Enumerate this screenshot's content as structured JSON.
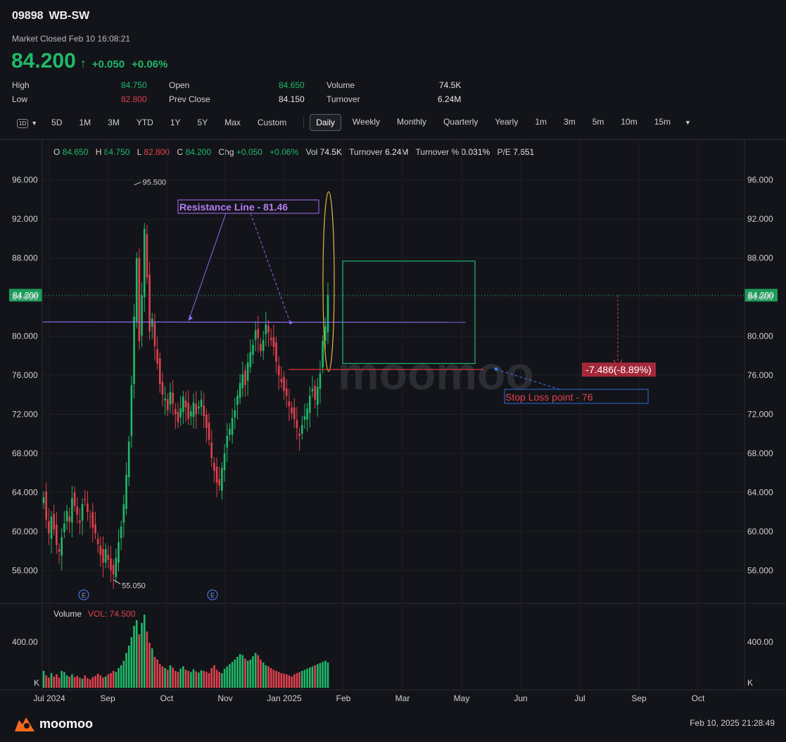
{
  "header": {
    "code": "09898",
    "name": "WB-SW",
    "market_status": "Market Closed Feb 10 16:08:21",
    "price": "84.200",
    "change": "+0.050",
    "change_pct": "+0.06%"
  },
  "stats": {
    "high_label": "High",
    "high": "84.750",
    "low_label": "Low",
    "low": "82.800",
    "open_label": "Open",
    "open": "84.650",
    "prev_close_label": "Prev Close",
    "prev_close": "84.150",
    "volume_label": "Volume",
    "volume": "74.5K",
    "turnover_label": "Turnover",
    "turnover": "6.24M"
  },
  "tabs": {
    "period_icon": "1D",
    "ranges": [
      "5D",
      "1M",
      "3M",
      "YTD",
      "1Y",
      "5Y",
      "Max",
      "Custom"
    ],
    "intervals": [
      "Daily",
      "Weekly",
      "Monthly",
      "Quarterly",
      "Yearly",
      "1m",
      "3m",
      "5m",
      "10m",
      "15m"
    ],
    "active": "Daily"
  },
  "ohlc_bar": {
    "o_label": "O",
    "o": "84.650",
    "h_label": "H",
    "h": "84.750",
    "l_label": "L",
    "l": "82.800",
    "c_label": "C",
    "c": "84.200",
    "chg_label": "Chg",
    "chg": "+0.050",
    "chg_pct": "+0.06%",
    "vol_label": "Vol",
    "vol": "74.5K",
    "turnover_label": "Turnover",
    "turnover": "6.24M",
    "turnover_pct_label": "Turnover %",
    "turnover_pct": "0.031%",
    "pe_label": "P/E",
    "pe": "7.651"
  },
  "chart_data": {
    "type": "candlestick",
    "y_ticks": [
      "96.000",
      "92.000",
      "88.000",
      "84.000",
      "80.000",
      "76.000",
      "72.000",
      "68.000",
      "64.000",
      "60.000",
      "56.000"
    ],
    "y_tick_values": [
      96,
      92,
      88,
      84,
      80,
      76,
      72,
      68,
      64,
      60,
      56
    ],
    "ylim": [
      53.5,
      98
    ],
    "x_ticks": [
      "Jul 2024",
      "Sep",
      "Oct",
      "Nov",
      "Jan 2025",
      "Feb",
      "Mar",
      "May",
      "Jun",
      "Jul",
      "Sep",
      "Oct"
    ],
    "last_price_label": "84.200",
    "last_price": 84.2,
    "high_marker": "95.500",
    "high_value": 95.5,
    "low_marker": "55.050",
    "low_value": 55.05,
    "earnings_marker": "E",
    "resistance_label": "Resistance Line - 81.46",
    "resistance_value": 81.46,
    "stop_loss_label": "Stop Loss point - 76",
    "stop_loss_value": 76.6,
    "drop_label": "-7.486(-8.89%)",
    "watermark": "moomoo",
    "closes": [
      63.5,
      61.2,
      59.8,
      61.5,
      60.2,
      58.6,
      57.9,
      59.4,
      60.8,
      62.1,
      61.0,
      63.4,
      62.6,
      61.7,
      60.9,
      62.8,
      63.2,
      62.0,
      61.5,
      60.4,
      59.8,
      58.7,
      57.6,
      56.8,
      58.2,
      57.1,
      56.0,
      55.6,
      57.3,
      58.9,
      60.5,
      62.8,
      65.8,
      69.2,
      75.0,
      82.0,
      88.0,
      79.5,
      84.2,
      91.0,
      86.0,
      80.5,
      81.8,
      79.0,
      77.2,
      75.1,
      74.0,
      73.6,
      72.4,
      74.3,
      73.1,
      72.0,
      71.2,
      72.6,
      73.8,
      72.7,
      71.5,
      72.3,
      73.2,
      72.0,
      72.8,
      73.5,
      71.8,
      70.6,
      69.4,
      67.5,
      66.2,
      65.0,
      64.7,
      66.5,
      68.0,
      69.8,
      70.5,
      71.6,
      72.4,
      73.9,
      75.2,
      76.1,
      75.0,
      77.3,
      78.4,
      79.1,
      80.6,
      79.8,
      78.5,
      79.6,
      81.2,
      80.4,
      79.6,
      78.9,
      77.4,
      76.0,
      75.3,
      74.4,
      73.9,
      72.8,
      72.1,
      71.5,
      70.6,
      69.8,
      70.9,
      71.8,
      72.6,
      73.9,
      74.6,
      73.5,
      74.8,
      76.2,
      79.5,
      81.0,
      84.2
    ],
    "volumes": [
      30,
      22,
      18,
      26,
      20,
      24,
      18,
      30,
      28,
      22,
      20,
      24,
      19,
      21,
      18,
      16,
      22,
      17,
      15,
      19,
      21,
      25,
      22,
      18,
      20,
      24,
      26,
      30,
      28,
      35,
      40,
      48,
      62,
      75,
      90,
      110,
      120,
      95,
      115,
      130,
      100,
      80,
      70,
      55,
      50,
      42,
      38,
      35,
      32,
      40,
      36,
      30,
      28,
      34,
      38,
      32,
      30,
      28,
      33,
      29,
      27,
      31,
      30,
      28,
      26,
      35,
      40,
      32,
      28,
      26,
      34,
      38,
      42,
      46,
      50,
      55,
      60,
      58,
      52,
      48,
      50,
      56,
      62,
      58,
      50,
      45,
      40,
      38,
      35,
      32,
      30,
      28,
      26,
      25,
      24,
      22,
      20,
      24,
      26,
      28,
      30,
      32,
      34,
      36,
      38,
      40,
      42,
      44,
      46,
      48,
      45
    ]
  }
}
